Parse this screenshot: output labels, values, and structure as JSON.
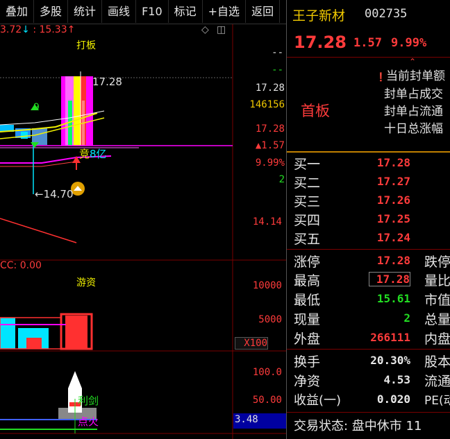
{
  "toolbar": {
    "items": [
      "叠加",
      "多股",
      "统计",
      "画线",
      "F10",
      "标记",
      "+自选",
      "返回"
    ]
  },
  "chart": {
    "top_left_a": "3.72",
    "top_left_b": ": 15.33",
    "top_label": "打板",
    "price_high_label": "17.28",
    "price_low_label": "14.70",
    "count_label": "9",
    "amount_label": "8亿",
    "amount_prefix": "竞",
    "right_axis": {
      "r1": "--",
      "r2": "--",
      "r3": "17.28",
      "r4": "146156",
      "r5": "17.28",
      "r6": "▲1.57",
      "r7": "9.99%",
      "r8": "2",
      "r9": "14.14",
      "r10": "10000",
      "r11": "5000",
      "r12": "X100",
      "r13": "100.0",
      "r14": "50.00",
      "r15": "3.48"
    },
    "vol_panel_label": "CC: 0.00",
    "vol_panel_title": "游资",
    "ind_label_1": "利剑",
    "ind_label_2": "点火"
  },
  "panel": {
    "name": "王子新材",
    "code": "002735",
    "price": "17.28",
    "change": "1.57",
    "change_pct": "9.99%",
    "status_tag": "首板",
    "seal_lines": [
      "当前封单额",
      "封单占成交",
      "封单占流通",
      "十日总涨幅"
    ],
    "bids": [
      {
        "label": "买一",
        "price": "17.28"
      },
      {
        "label": "买二",
        "price": "17.27"
      },
      {
        "label": "买三",
        "price": "17.26"
      },
      {
        "label": "买四",
        "price": "17.25"
      },
      {
        "label": "买五",
        "price": "17.24"
      }
    ],
    "stats": [
      {
        "label": "涨停",
        "value": "17.28",
        "right": "跌停",
        "color": "#ff3b3b"
      },
      {
        "label": "最高",
        "value": "17.28",
        "right": "量比",
        "color": "#ff3b3b"
      },
      {
        "label": "最低",
        "value": "15.61",
        "right": "市值",
        "color": "#22dd22"
      },
      {
        "label": "现量",
        "value": "2",
        "right": "总量",
        "color": "#22dd22"
      },
      {
        "label": "外盘",
        "value": "266111",
        "right": "内盘",
        "color": "#ff3b3b"
      }
    ],
    "stats2": [
      {
        "label": "换手",
        "value": "20.30%",
        "right": "股本"
      },
      {
        "label": "净资",
        "value": "4.53",
        "right": "流通"
      },
      {
        "label": "收益(一)",
        "value": "0.020",
        "right": "PE(动"
      }
    ],
    "trade_status": "交易状态: 盘中休市 11"
  },
  "colors": {
    "red": "#ff3b3b",
    "green": "#22dd22",
    "yellow": "#f0f000",
    "magenta": "#ff00ff",
    "cyan": "#00e5ff",
    "dark_red": "#7a0000"
  }
}
